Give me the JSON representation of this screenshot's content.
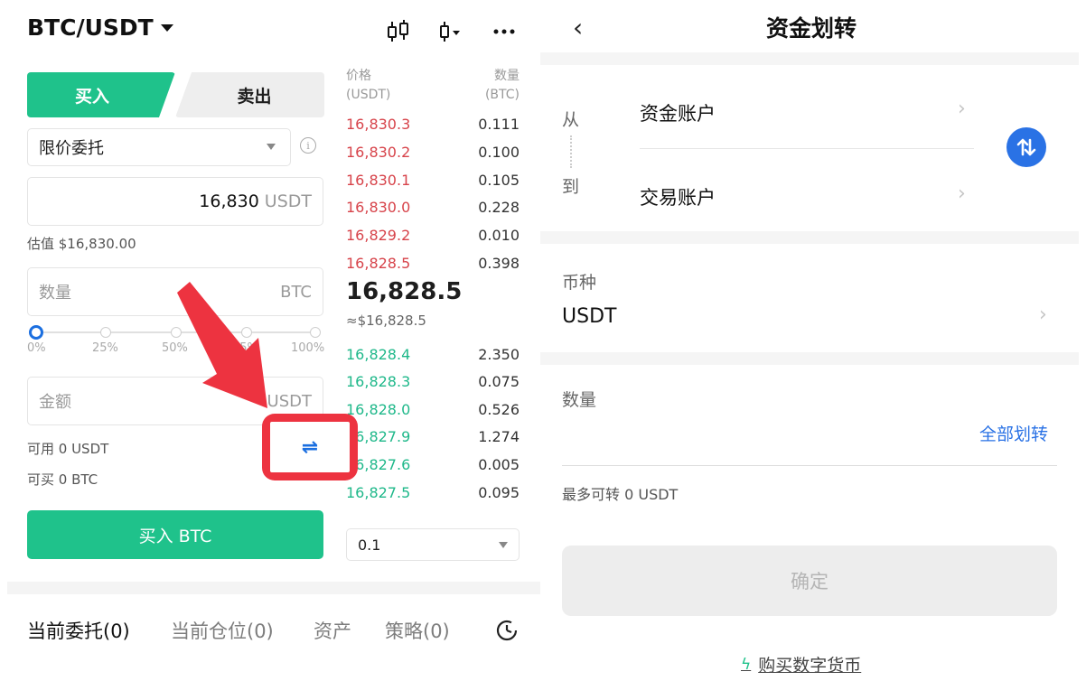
{
  "left": {
    "pair": "BTC/USDT",
    "tabs": {
      "buy": "买入",
      "sell": "卖出"
    },
    "order_type": "限价委托",
    "price_input": {
      "value": "16,830",
      "unit": "USDT"
    },
    "estimate": "估值 $16,830.00",
    "quantity_input": {
      "placeholder": "数量",
      "unit": "BTC"
    },
    "slider": {
      "labels": [
        "0%",
        "25%",
        "50%",
        "75%",
        "100%"
      ],
      "value_percent": 0
    },
    "amount_input": {
      "placeholder": "金额",
      "unit": "USDT"
    },
    "available": "可用 0 USDT",
    "can_buy": "可买 0 BTC",
    "transfer_icon_glyph": "⇌",
    "buy_button": "买入 BTC",
    "orderbook": {
      "price_header": [
        "价格",
        "(USDT)"
      ],
      "qty_header": [
        "数量",
        "(BTC)"
      ],
      "asks": [
        {
          "price": "16,830.3",
          "qty": "0.111"
        },
        {
          "price": "16,830.2",
          "qty": "0.100"
        },
        {
          "price": "16,830.1",
          "qty": "0.105"
        },
        {
          "price": "16,830.0",
          "qty": "0.228"
        },
        {
          "price": "16,829.2",
          "qty": "0.010"
        },
        {
          "price": "16,828.5",
          "qty": "0.398"
        }
      ],
      "last_price": "16,828.5",
      "last_price_usd": "≈$16,828.5",
      "bids": [
        {
          "price": "16,828.4",
          "qty": "2.350"
        },
        {
          "price": "16,828.3",
          "qty": "0.075"
        },
        {
          "price": "16,828.0",
          "qty": "0.526"
        },
        {
          "price": "16,827.9",
          "qty": "1.274"
        },
        {
          "price": "16,827.6",
          "qty": "0.005"
        },
        {
          "price": "16,827.5",
          "qty": "0.095"
        }
      ],
      "depth": "0.1"
    },
    "bottom_tabs": [
      "当前委托(0)",
      "当前仓位(0)",
      "资产",
      "策略(0)"
    ],
    "colors": {
      "green": "#1fc28b",
      "red": "#d7434a",
      "highlight": "#ed3340",
      "blue": "#1b6fe0"
    }
  },
  "right": {
    "back": "‹",
    "title": "资金划转",
    "from_label": "从",
    "to_label": "到",
    "from_account": "资金账户",
    "to_account": "交易账户",
    "chevron": "›",
    "currency_label": "币种",
    "currency_value": "USDT",
    "quantity_label": "数量",
    "transfer_all": "全部划转",
    "max_transferable": "最多可转 0 USDT",
    "confirm": "确定",
    "buy_crypto": "购买数字货币",
    "bolt_glyph": "ϟ",
    "colors": {
      "accent": "#2a72e5"
    }
  }
}
